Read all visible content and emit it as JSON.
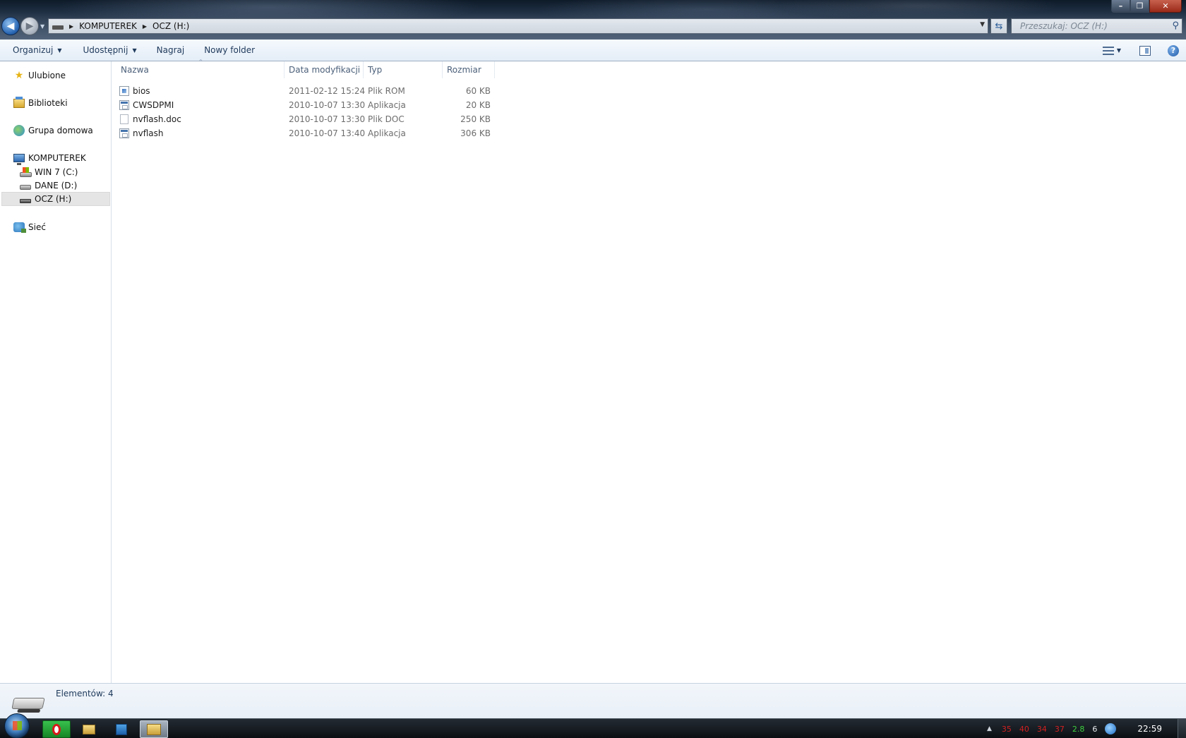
{
  "window": {
    "controls": {
      "minimize": "–",
      "maximize": "❐",
      "close": "✕"
    }
  },
  "address": {
    "crumbs": [
      "KOMPUTEREK",
      "OCZ (H:)"
    ]
  },
  "search": {
    "placeholder": "Przeszukaj: OCZ (H:)"
  },
  "toolbar": {
    "organize": "Organizuj",
    "share": "Udostępnij",
    "burn": "Nagraj",
    "new_folder": "Nowy folder"
  },
  "sidebar": {
    "favorites": "Ulubione",
    "libraries": "Biblioteki",
    "homegroup": "Grupa domowa",
    "computer": "KOMPUTEREK",
    "drives": [
      {
        "label": "WIN 7 (C:)",
        "icon": "system-drive-icon"
      },
      {
        "label": "DANE (D:)",
        "icon": "hard-drive-icon"
      },
      {
        "label": "OCZ (H:)",
        "icon": "usb-drive-icon",
        "selected": true
      }
    ],
    "network": "Sieć"
  },
  "columns": {
    "name": "Nazwa",
    "modified": "Data modyfikacji",
    "type": "Typ",
    "size": "Rozmiar"
  },
  "files": [
    {
      "name": "bios",
      "modified": "2011-02-12 15:24",
      "type": "Plik ROM",
      "size": "60 KB",
      "icon": "rom-file-icon"
    },
    {
      "name": "CWSDPMI",
      "modified": "2010-10-07 13:30",
      "type": "Aplikacja",
      "size": "20 KB",
      "icon": "application-icon"
    },
    {
      "name": "nvflash.doc",
      "modified": "2010-10-07 13:30",
      "type": "Plik DOC",
      "size": "250 KB",
      "icon": "document-icon"
    },
    {
      "name": "nvflash",
      "modified": "2010-10-07 13:40",
      "type": "Aplikacja",
      "size": "306 KB",
      "icon": "application-icon"
    }
  ],
  "details": {
    "count_text": "Elementów: 4"
  },
  "taskbar": {
    "tray_values": [
      {
        "value": "35",
        "color": "#d22020"
      },
      {
        "value": "40",
        "color": "#d22020"
      },
      {
        "value": "34",
        "color": "#d22020"
      },
      {
        "value": "37",
        "color": "#d22020"
      },
      {
        "value": "2.8",
        "color": "#3fcf3f"
      },
      {
        "value": "6",
        "color": "#e8ecef"
      }
    ],
    "clock": "22:59"
  }
}
